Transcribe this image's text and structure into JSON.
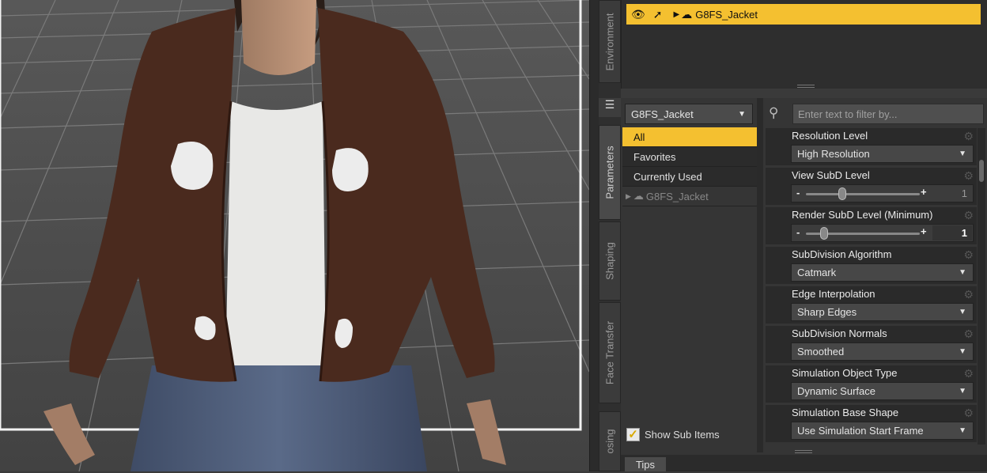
{
  "scene": {
    "row_label": "G8FS_Jacket",
    "eye_icon": "eye-icon",
    "select_icon": "arrow-cursor-icon"
  },
  "tabs": {
    "environment": "Environment",
    "parameters": "Parameters",
    "shaping": "Shaping",
    "face_transfer": "Face Transfer",
    "posing": "osing"
  },
  "node_dropdown": {
    "value": "G8FS_Jacket"
  },
  "categories": [
    {
      "label": "All",
      "selected": true
    },
    {
      "label": "Favorites"
    },
    {
      "label": "Currently Used"
    }
  ],
  "node_item": {
    "label": "G8FS_Jacket"
  },
  "show_sub_items": {
    "label": "Show Sub Items",
    "checked": true
  },
  "filter": {
    "placeholder": "Enter text to filter by..."
  },
  "params": [
    {
      "title": "Resolution Level",
      "type": "select",
      "value": "High Resolution"
    },
    {
      "title": "View SubD Level",
      "type": "slider",
      "value": "1",
      "fraction": 0.32,
      "active": false
    },
    {
      "title": "Render SubD Level (Minimum)",
      "type": "slider",
      "value": "1",
      "fraction": 0.16,
      "active": true
    },
    {
      "title": "SubDivision Algorithm",
      "type": "select",
      "value": "Catmark"
    },
    {
      "title": "Edge Interpolation",
      "type": "select",
      "value": "Sharp Edges"
    },
    {
      "title": "SubDivision Normals",
      "type": "select",
      "value": "Smoothed"
    },
    {
      "title": "Simulation Object Type",
      "type": "select",
      "value": "Dynamic Surface"
    },
    {
      "title": "Simulation Base Shape",
      "type": "select",
      "value": "Use Simulation Start Frame"
    }
  ],
  "tips": {
    "label": "Tips"
  },
  "colors": {
    "accent": "#f4c030",
    "panel": "#353535",
    "jacket": "#4a2a1e"
  }
}
